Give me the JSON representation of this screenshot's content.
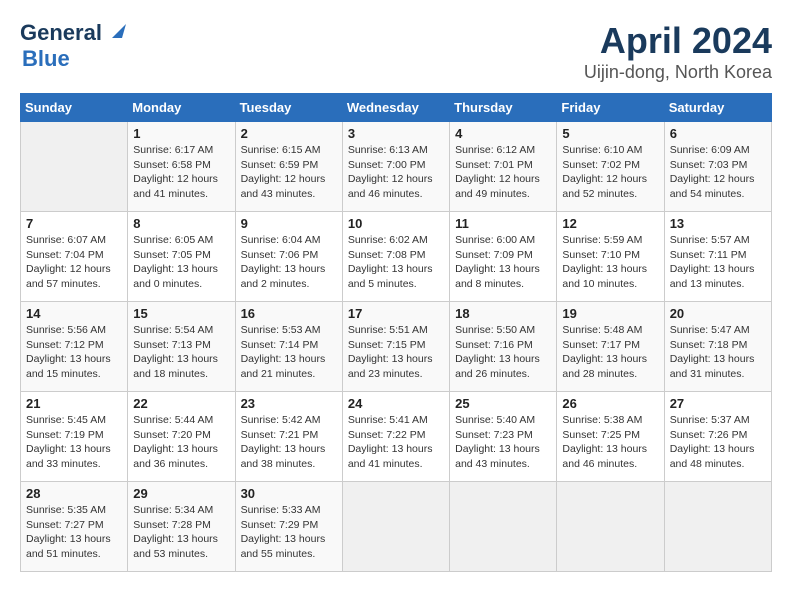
{
  "header": {
    "logo_line1": "General",
    "logo_line2": "Blue",
    "title": "April 2024",
    "subtitle": "Uijin-dong, North Korea"
  },
  "calendar": {
    "days_of_week": [
      "Sunday",
      "Monday",
      "Tuesday",
      "Wednesday",
      "Thursday",
      "Friday",
      "Saturday"
    ],
    "weeks": [
      [
        {
          "day": "",
          "detail": ""
        },
        {
          "day": "1",
          "detail": "Sunrise: 6:17 AM\nSunset: 6:58 PM\nDaylight: 12 hours\nand 41 minutes."
        },
        {
          "day": "2",
          "detail": "Sunrise: 6:15 AM\nSunset: 6:59 PM\nDaylight: 12 hours\nand 43 minutes."
        },
        {
          "day": "3",
          "detail": "Sunrise: 6:13 AM\nSunset: 7:00 PM\nDaylight: 12 hours\nand 46 minutes."
        },
        {
          "day": "4",
          "detail": "Sunrise: 6:12 AM\nSunset: 7:01 PM\nDaylight: 12 hours\nand 49 minutes."
        },
        {
          "day": "5",
          "detail": "Sunrise: 6:10 AM\nSunset: 7:02 PM\nDaylight: 12 hours\nand 52 minutes."
        },
        {
          "day": "6",
          "detail": "Sunrise: 6:09 AM\nSunset: 7:03 PM\nDaylight: 12 hours\nand 54 minutes."
        }
      ],
      [
        {
          "day": "7",
          "detail": "Sunrise: 6:07 AM\nSunset: 7:04 PM\nDaylight: 12 hours\nand 57 minutes."
        },
        {
          "day": "8",
          "detail": "Sunrise: 6:05 AM\nSunset: 7:05 PM\nDaylight: 13 hours\nand 0 minutes."
        },
        {
          "day": "9",
          "detail": "Sunrise: 6:04 AM\nSunset: 7:06 PM\nDaylight: 13 hours\nand 2 minutes."
        },
        {
          "day": "10",
          "detail": "Sunrise: 6:02 AM\nSunset: 7:08 PM\nDaylight: 13 hours\nand 5 minutes."
        },
        {
          "day": "11",
          "detail": "Sunrise: 6:00 AM\nSunset: 7:09 PM\nDaylight: 13 hours\nand 8 minutes."
        },
        {
          "day": "12",
          "detail": "Sunrise: 5:59 AM\nSunset: 7:10 PM\nDaylight: 13 hours\nand 10 minutes."
        },
        {
          "day": "13",
          "detail": "Sunrise: 5:57 AM\nSunset: 7:11 PM\nDaylight: 13 hours\nand 13 minutes."
        }
      ],
      [
        {
          "day": "14",
          "detail": "Sunrise: 5:56 AM\nSunset: 7:12 PM\nDaylight: 13 hours\nand 15 minutes."
        },
        {
          "day": "15",
          "detail": "Sunrise: 5:54 AM\nSunset: 7:13 PM\nDaylight: 13 hours\nand 18 minutes."
        },
        {
          "day": "16",
          "detail": "Sunrise: 5:53 AM\nSunset: 7:14 PM\nDaylight: 13 hours\nand 21 minutes."
        },
        {
          "day": "17",
          "detail": "Sunrise: 5:51 AM\nSunset: 7:15 PM\nDaylight: 13 hours\nand 23 minutes."
        },
        {
          "day": "18",
          "detail": "Sunrise: 5:50 AM\nSunset: 7:16 PM\nDaylight: 13 hours\nand 26 minutes."
        },
        {
          "day": "19",
          "detail": "Sunrise: 5:48 AM\nSunset: 7:17 PM\nDaylight: 13 hours\nand 28 minutes."
        },
        {
          "day": "20",
          "detail": "Sunrise: 5:47 AM\nSunset: 7:18 PM\nDaylight: 13 hours\nand 31 minutes."
        }
      ],
      [
        {
          "day": "21",
          "detail": "Sunrise: 5:45 AM\nSunset: 7:19 PM\nDaylight: 13 hours\nand 33 minutes."
        },
        {
          "day": "22",
          "detail": "Sunrise: 5:44 AM\nSunset: 7:20 PM\nDaylight: 13 hours\nand 36 minutes."
        },
        {
          "day": "23",
          "detail": "Sunrise: 5:42 AM\nSunset: 7:21 PM\nDaylight: 13 hours\nand 38 minutes."
        },
        {
          "day": "24",
          "detail": "Sunrise: 5:41 AM\nSunset: 7:22 PM\nDaylight: 13 hours\nand 41 minutes."
        },
        {
          "day": "25",
          "detail": "Sunrise: 5:40 AM\nSunset: 7:23 PM\nDaylight: 13 hours\nand 43 minutes."
        },
        {
          "day": "26",
          "detail": "Sunrise: 5:38 AM\nSunset: 7:25 PM\nDaylight: 13 hours\nand 46 minutes."
        },
        {
          "day": "27",
          "detail": "Sunrise: 5:37 AM\nSunset: 7:26 PM\nDaylight: 13 hours\nand 48 minutes."
        }
      ],
      [
        {
          "day": "28",
          "detail": "Sunrise: 5:35 AM\nSunset: 7:27 PM\nDaylight: 13 hours\nand 51 minutes."
        },
        {
          "day": "29",
          "detail": "Sunrise: 5:34 AM\nSunset: 7:28 PM\nDaylight: 13 hours\nand 53 minutes."
        },
        {
          "day": "30",
          "detail": "Sunrise: 5:33 AM\nSunset: 7:29 PM\nDaylight: 13 hours\nand 55 minutes."
        },
        {
          "day": "",
          "detail": ""
        },
        {
          "day": "",
          "detail": ""
        },
        {
          "day": "",
          "detail": ""
        },
        {
          "day": "",
          "detail": ""
        }
      ]
    ]
  }
}
